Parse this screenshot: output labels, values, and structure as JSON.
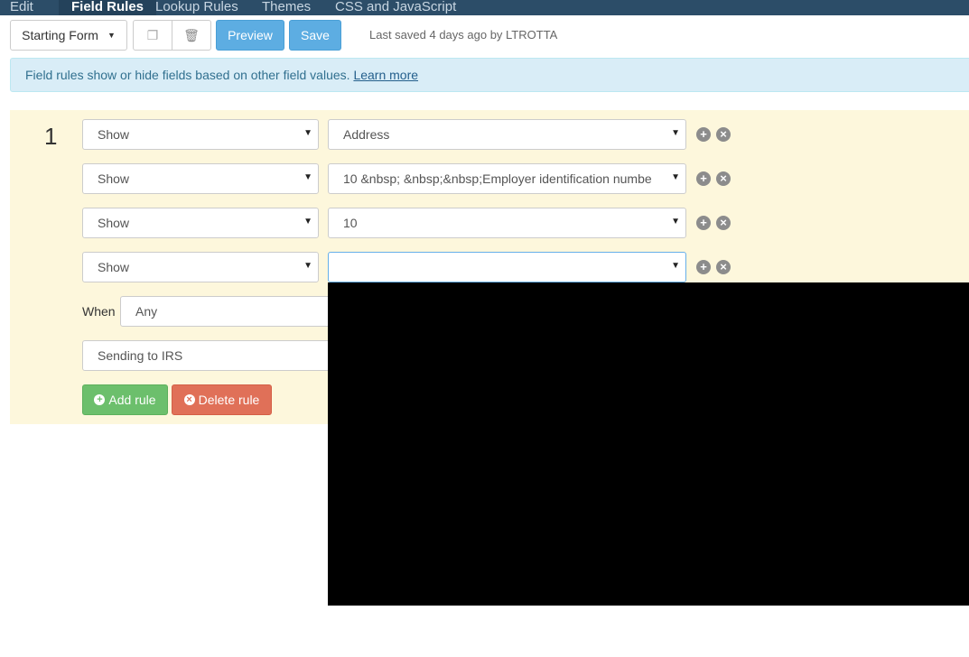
{
  "nav": {
    "tabs": [
      {
        "label": "Edit"
      },
      {
        "label": "Field Rules",
        "active": true
      },
      {
        "label": "Lookup Rules"
      },
      {
        "label": "Themes"
      },
      {
        "label": "CSS and JavaScript"
      }
    ]
  },
  "toolbar": {
    "form_select": "Starting Form",
    "preview": "Preview",
    "save": "Save",
    "last_saved": "Last saved 4 days ago by LTROTTA"
  },
  "alert": {
    "text": "Field rules show or hide fields based on other field values. ",
    "link": "Learn more"
  },
  "rule": {
    "number": "1",
    "actions": [
      {
        "action": "Show",
        "field": "Address"
      },
      {
        "action": "Show",
        "field": "10 &nbsp; &nbsp;&nbsp;Employer identification numbe"
      },
      {
        "action": "Show",
        "field": "10"
      },
      {
        "action": "Show",
        "field": ""
      }
    ],
    "when_label": "When",
    "when_value": "Any",
    "condition_field": "Sending to IRS",
    "add_rule": "Add rule",
    "delete_rule": "Delete rule"
  },
  "colors": {
    "nav": "#2c4d68",
    "primary": "#5dade2",
    "success": "#6cbf6c",
    "danger": "#e07058",
    "panel": "#fdf7dc"
  }
}
